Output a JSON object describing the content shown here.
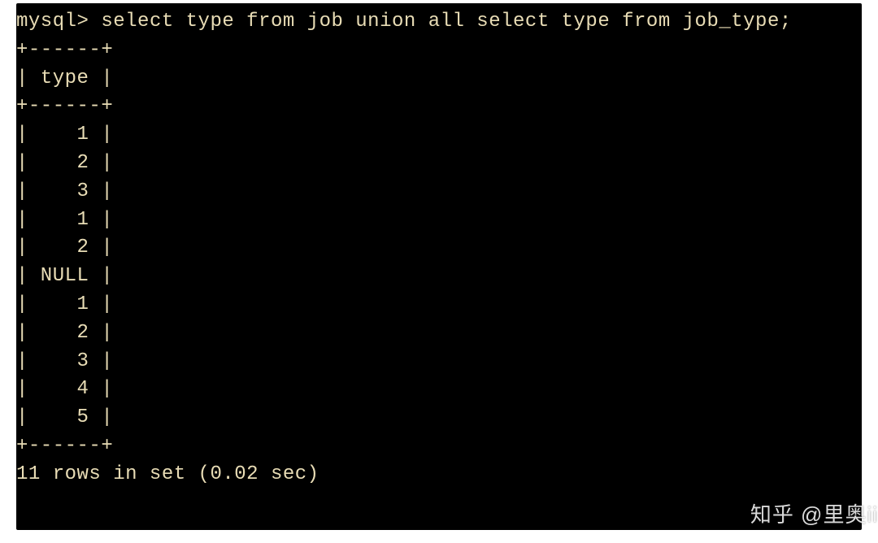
{
  "prompt": "mysql> ",
  "query": "select type from job union all select type from job_type;",
  "table": {
    "border_top": "+------+",
    "header": "| type |",
    "border_mid": "+------+",
    "rows": [
      "|    1 |",
      "|    2 |",
      "|    3 |",
      "|    1 |",
      "|    2 |",
      "| NULL |",
      "|    1 |",
      "|    2 |",
      "|    3 |",
      "|    4 |",
      "|    5 |"
    ],
    "border_bot": "+------+"
  },
  "summary": "11 rows in set (0.02 sec)",
  "watermark": "知乎 @里奥ii"
}
